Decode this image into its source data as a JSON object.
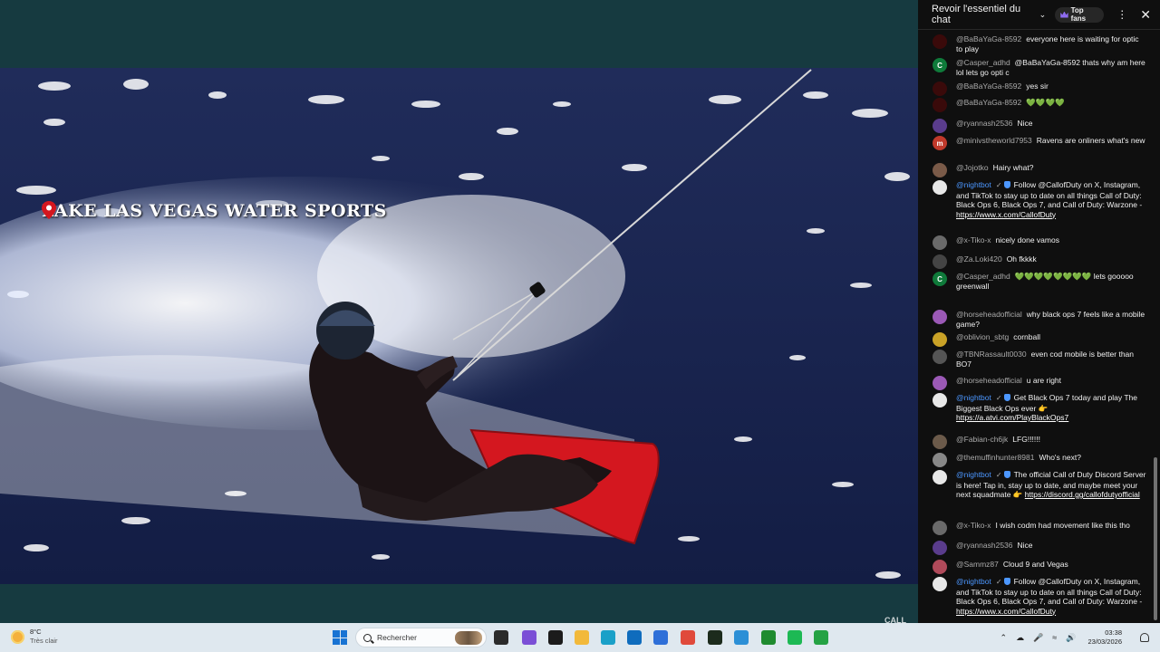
{
  "video": {
    "location_label": "LAKE LAS VEGAS WATER SPORTS",
    "watermark": "CALL",
    "colors": {
      "water": "#14224a",
      "spray": "#ffffff",
      "board": "#d4171f"
    }
  },
  "chat": {
    "title": "Revoir l'essentiel du chat",
    "top_fans_label": "Top fans",
    "messages": [
      {
        "author": "@BaBaYaGa-8592",
        "text": "everyone here is waiting for optic to play",
        "avatar_color": "#3a0a0a",
        "avatar_letter": ""
      },
      {
        "author": "@Casper_adhd",
        "text": "@BaBaYaGa-8592 thats why am here lol lets go opti c",
        "avatar_color": "#0f7a3a",
        "avatar_letter": "C"
      },
      {
        "author": "@BaBaYaGa-8592",
        "text": "yes sir",
        "avatar_color": "#3a0a0a",
        "avatar_letter": ""
      },
      {
        "author": "@BaBaYaGa-8592",
        "text": "💚💚💚💚",
        "avatar_color": "#3a0a0a",
        "avatar_letter": ""
      },
      {
        "author": "@ryannash2536",
        "text": "Nice",
        "avatar_color": "#5a3c8c",
        "avatar_letter": ""
      },
      {
        "author": "@minivstheworld7953",
        "text": "Ravens are onliners what's new",
        "avatar_color": "#c0392b",
        "avatar_letter": "m"
      },
      {
        "author": "@Jojotko",
        "text": "Hairy what?",
        "avatar_color": "#7a5a48",
        "avatar_letter": ""
      },
      {
        "author": "@nightbot",
        "text": "Follow @CallofDuty on X, Instagram, and TikTok to stay up to date on all things Call of Duty: Black Ops 6, Black Ops 7, and Call of Duty: Warzone - ",
        "link": "https://www.x.com/CallofDuty",
        "avatar_color": "#e8e8e8",
        "avatar_letter": "",
        "bot": true
      },
      {
        "author": "@x-Tiko-x",
        "text": "nicely done vamos",
        "avatar_color": "#6a6a6a",
        "avatar_letter": ""
      },
      {
        "author": "@Za.Loki420",
        "text": "Oh fkkkk",
        "avatar_color": "#444444",
        "avatar_letter": ""
      },
      {
        "author": "@Casper_adhd",
        "text": "💚💚💚💚💚💚💚💚 lets gooooo greenwall",
        "avatar_color": "#0f7a3a",
        "avatar_letter": "C"
      },
      {
        "author": "@horseheadofficial",
        "text": "why black ops 7 feels like a mobile game?",
        "avatar_color": "#9b59b6",
        "avatar_letter": ""
      },
      {
        "author": "@oblivion_sbtg",
        "text": "cornball",
        "avatar_color": "#c9a227",
        "avatar_letter": ""
      },
      {
        "author": "@TBNRassault0030",
        "text": "even cod mobile is better than BO7",
        "avatar_color": "#555555",
        "avatar_letter": ""
      },
      {
        "author": "@horseheadofficial",
        "text": "u are right",
        "avatar_color": "#9b59b6",
        "avatar_letter": ""
      },
      {
        "author": "@nightbot",
        "text": "Get Black Ops 7 today and play The Biggest Black Ops ever 👉 ",
        "link": "https://a.atvi.com/PlayBlackOps7",
        "avatar_color": "#e8e8e8",
        "avatar_letter": "",
        "bot": true
      },
      {
        "author": "@Fabian-ch6jk",
        "text": "LFG!!!!!!",
        "avatar_color": "#6b5a4a",
        "avatar_letter": ""
      },
      {
        "author": "@themuffinhunter8981",
        "text": "Who's next?",
        "avatar_color": "#888888",
        "avatar_letter": ""
      },
      {
        "author": "@nightbot",
        "text": "The official Call of Duty Discord Server is here! Tap in, stay up to date, and maybe meet your next squadmate 👉 ",
        "link": "https://discord.gg/callofdutyofficial",
        "avatar_color": "#e8e8e8",
        "avatar_letter": "",
        "bot": true
      },
      {
        "author": "@x-Tiko-x",
        "text": "I wish codm had movement like this tho",
        "avatar_color": "#6a6a6a",
        "avatar_letter": ""
      },
      {
        "author": "@ryannash2536",
        "text": "Nice",
        "avatar_color": "#5a3c8c",
        "avatar_letter": ""
      },
      {
        "author": "@Sammz87",
        "text": "Cloud 9 and Vegas",
        "avatar_color": "#b04a5a",
        "avatar_letter": ""
      },
      {
        "author": "@nightbot",
        "text": "Follow @CallofDuty on X, Instagram, and TikTok to stay up to date on all things Call of Duty: Black Ops 6, Black Ops 7, and Call of Duty: Warzone - ",
        "link": "https://www.x.com/CallofDuty",
        "avatar_color": "#e8e8e8",
        "avatar_letter": "",
        "bot": true
      }
    ]
  },
  "taskbar": {
    "weather_temp": "8°C",
    "weather_desc": "Très clair",
    "search_placeholder": "Rechercher",
    "time": "03:38",
    "date": "23/03/2026",
    "apps": [
      {
        "name": "task-view-icon",
        "color": "#2b2b2b"
      },
      {
        "name": "store-icon",
        "color": "#7b4fd6"
      },
      {
        "name": "speedometer-icon",
        "color": "#1b1b1b"
      },
      {
        "name": "file-explorer-icon",
        "color": "#f2b93b"
      },
      {
        "name": "edge-icon",
        "color": "#1aa0c8"
      },
      {
        "name": "outlook-icon",
        "color": "#0f6cbd"
      },
      {
        "name": "calendar-app-icon",
        "color": "#2e6fd8"
      },
      {
        "name": "chrome-icon",
        "color": "#e04a3b"
      },
      {
        "name": "terminal-app-icon",
        "color": "#1c2b1c"
      },
      {
        "name": "photos-icon",
        "color": "#2c8fd6"
      },
      {
        "name": "xbox-icon",
        "color": "#1f8b2f"
      },
      {
        "name": "spotify-icon",
        "color": "#1db954"
      },
      {
        "name": "whatsapp-icon",
        "color": "#25a244"
      }
    ]
  }
}
